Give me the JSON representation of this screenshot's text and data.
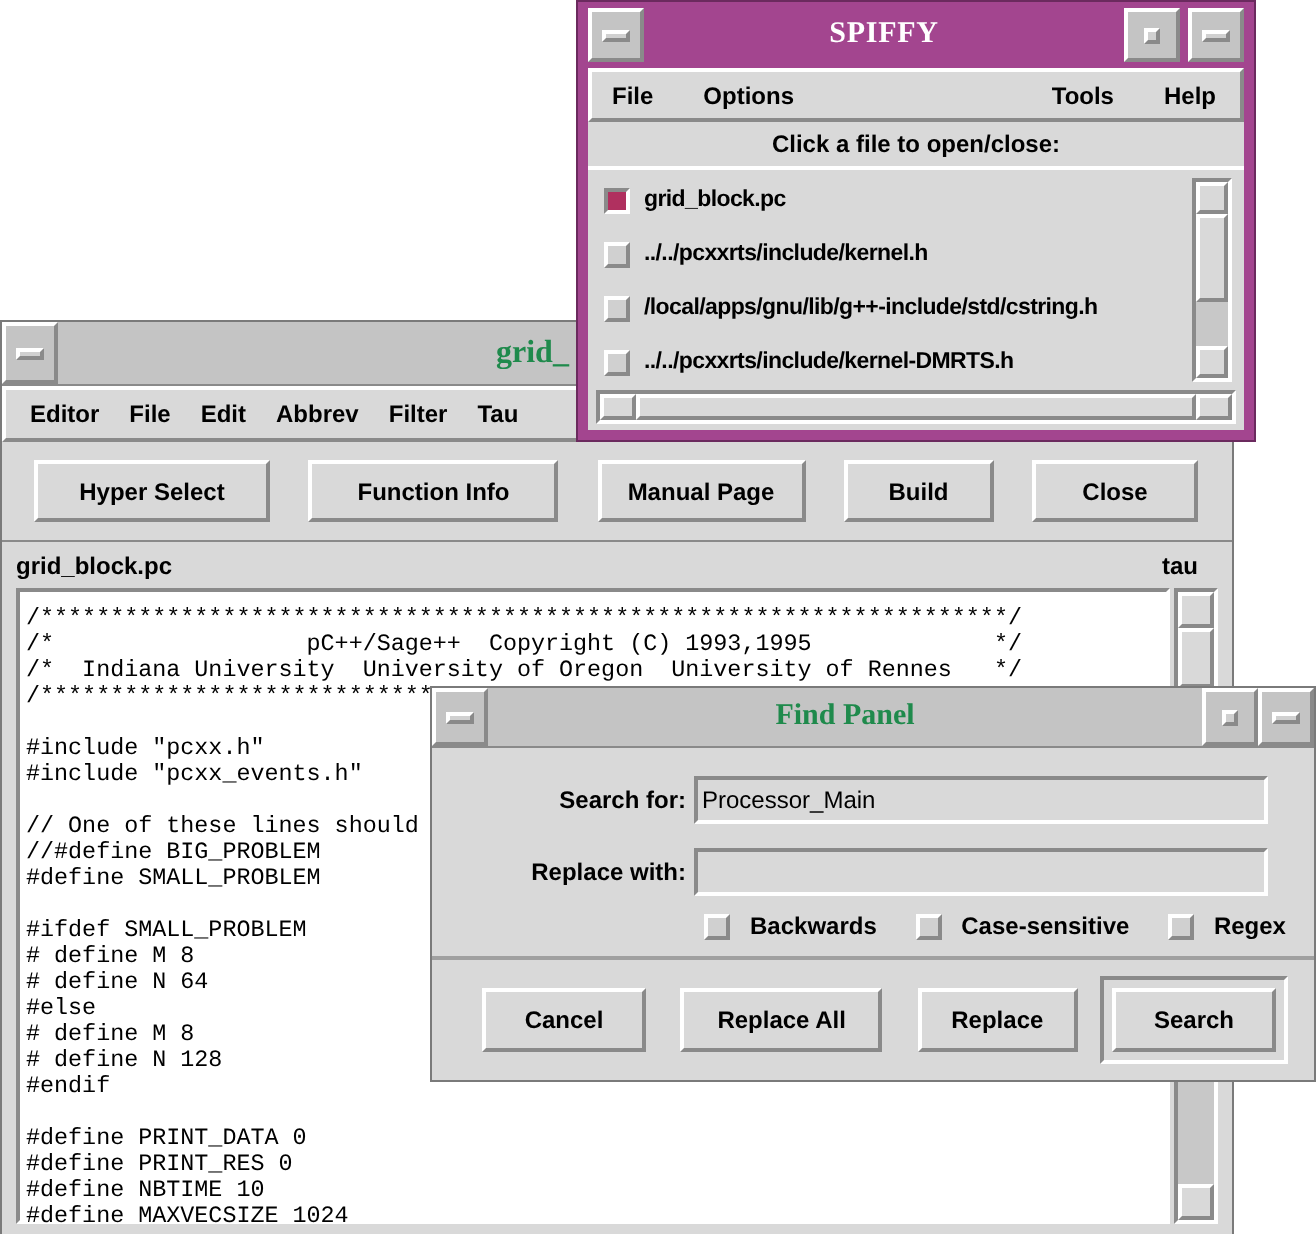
{
  "editor_window": {
    "title": "grid_",
    "menu": [
      "Editor",
      "File",
      "Edit",
      "Abbrev",
      "Filter",
      "Tau"
    ],
    "buttons": [
      "Hyper Select",
      "Function Info",
      "Manual Page",
      "Build",
      "Close"
    ],
    "file_label": "grid_block.pc",
    "tau_label": "tau",
    "code_lines": [
      {
        "text": "/*********************************************************************/",
        "gap_before": false
      },
      {
        "text": "/*                  pC++/Sage++  Copyright (C) 1993,1995             */",
        "gap_before": false
      },
      {
        "text": "/*  Indiana University  University of Oregon  University of Rennes   */",
        "gap_before": false
      },
      {
        "text": "/****************************",
        "gap_before": false
      },
      {
        "text": "#include \"pcxx.h\"",
        "gap_before": true
      },
      {
        "text": "#include \"pcxx_events.h\"",
        "gap_before": false
      },
      {
        "text": "// One of these lines should",
        "gap_before": true
      },
      {
        "text": "//#define BIG_PROBLEM",
        "gap_before": false
      },
      {
        "text": "#define SMALL_PROBLEM",
        "gap_before": false
      },
      {
        "text": "#ifdef SMALL_PROBLEM",
        "gap_before": true
      },
      {
        "text": "# define M 8",
        "gap_before": false
      },
      {
        "text": "# define N 64",
        "gap_before": false
      },
      {
        "text": "#else",
        "gap_before": false
      },
      {
        "text": "# define M 8",
        "gap_before": false
      },
      {
        "text": "# define N 128",
        "gap_before": false
      },
      {
        "text": "#endif",
        "gap_before": false
      },
      {
        "text": "#define PRINT_DATA 0",
        "gap_before": true
      },
      {
        "text": "#define PRINT_RES 0",
        "gap_before": false
      },
      {
        "text": "#define NBTIME 10",
        "gap_before": false
      },
      {
        "text": "#define MAXVECSIZE 1024",
        "gap_before": false
      }
    ]
  },
  "spiffy_window": {
    "title": "SPIFFY",
    "menu_left": [
      "File",
      "Options"
    ],
    "menu_right": [
      "Tools",
      "Help"
    ],
    "prompt": "Click a file to open/close:",
    "files": [
      {
        "name": "grid_block.pc",
        "selected": true
      },
      {
        "name": "../../pcxxrts/include/kernel.h",
        "selected": false
      },
      {
        "name": "/local/apps/gnu/lib/g++-include/std/cstring.h",
        "selected": false
      },
      {
        "name": "../../pcxxrts/include/kernel-DMRTS.h",
        "selected": false
      }
    ]
  },
  "find_panel": {
    "title": "Find Panel",
    "search_label": "Search for:",
    "search_value": "Processor_Main",
    "replace_label": "Replace with:",
    "options": [
      {
        "label": "Backwards",
        "checked": false
      },
      {
        "label": "Case-sensitive",
        "checked": false
      },
      {
        "label": "Regex",
        "checked": false
      }
    ],
    "buttons": [
      {
        "label": "Cancel",
        "default": false
      },
      {
        "label": "Replace All",
        "default": false
      },
      {
        "label": "Replace",
        "default": false
      },
      {
        "label": "Search",
        "default": true
      }
    ]
  }
}
